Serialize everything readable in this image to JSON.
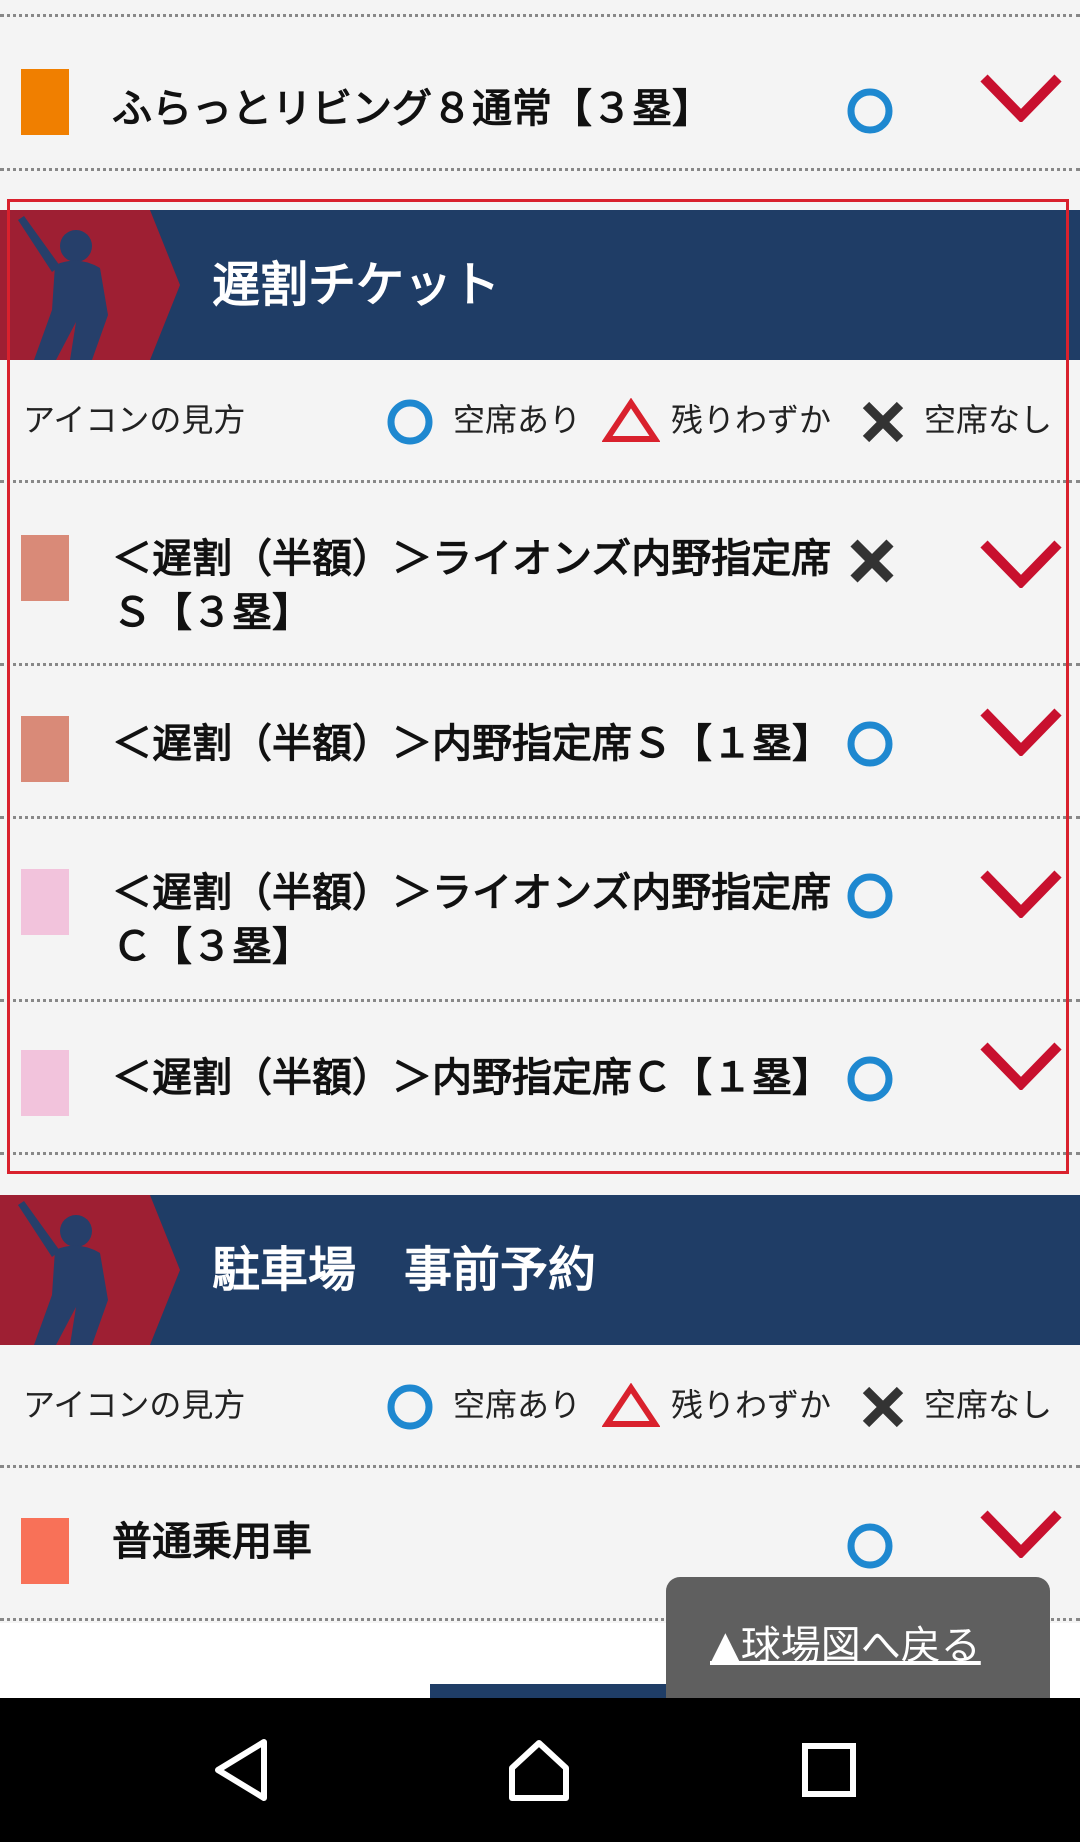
{
  "colors": {
    "header_bg": "#1f3d66",
    "badge_red": "#9e1f33",
    "available_blue": "#1e88d0",
    "few_left_red": "#d9212d",
    "chevron_red": "#c8102e",
    "highlight_border": "#d9212d",
    "swatch_orange": "#f07f00",
    "swatch_salmon": "#d98a78",
    "swatch_pink": "#f2c3dc",
    "swatch_coral": "#f87158"
  },
  "top_item": {
    "label": "ふらっとリビング８通常【３塁】",
    "status_icon": "available-circle-icon"
  },
  "late_discount_section": {
    "title": "遅割チケット",
    "legend": {
      "title": "アイコンの見方",
      "available": "空席あり",
      "few_left": "残りわずか",
      "sold_out": "空席なし"
    },
    "items": [
      {
        "label_line1": "＜遅割（半額）＞ライオンズ内野指定席",
        "label_line2": "Ｓ【３塁】",
        "status_icon": "sold-out-cross-icon"
      },
      {
        "label_line1": "＜遅割（半額）＞内野指定席Ｓ【１塁】",
        "label_line2": "",
        "status_icon": "available-circle-icon"
      },
      {
        "label_line1": "＜遅割（半額）＞ライオンズ内野指定席",
        "label_line2": "Ｃ【３塁】",
        "status_icon": "available-circle-icon"
      },
      {
        "label_line1": "＜遅割（半額）＞内野指定席Ｃ【１塁】",
        "label_line2": "",
        "status_icon": "available-circle-icon"
      }
    ]
  },
  "parking_section": {
    "title": "駐車場　事前予約",
    "legend": {
      "title": "アイコンの見方",
      "available": "空席あり",
      "few_left": "残りわずか",
      "sold_out": "空席なし"
    },
    "items": [
      {
        "label": "普通乗用車",
        "status_icon": "available-circle-icon"
      }
    ]
  },
  "floating_button": {
    "label": "▲球場図へ戻る"
  },
  "navbar": {
    "back": "back-icon",
    "home": "home-icon",
    "recents": "recents-icon"
  }
}
